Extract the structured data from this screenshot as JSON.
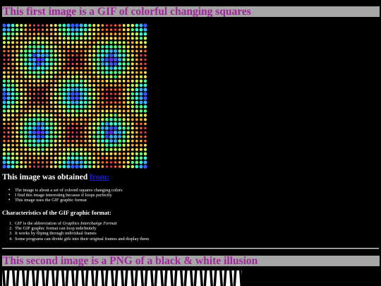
{
  "section1": {
    "heading": "This first image is a GIF of colorful changing squares",
    "obtained_prefix": "This image was obtained ",
    "obtained_link": "from:",
    "bullets": [
      "The image is about a set of colored squares changing colors",
      "I find this image interesting because if loops perfectly",
      "This image uses the GIF graphic format"
    ],
    "characteristics_heading": "Characteristics of the GIF graphic format:",
    "ordered": [
      {
        "num": "1.",
        "text": "GIF is the abbreviation of ",
        "em": "Graphics Interchange Format"
      },
      {
        "num": "2.",
        "text": "The GIF graphic format can loop indefinitely",
        "em": ""
      },
      {
        "num": "3.",
        "text": "It works by fliping through individual frames",
        "em": ""
      },
      {
        "num": "4.",
        "text": "Some programs can divide gifs into their original frames and display them",
        "em": ""
      }
    ]
  },
  "section2": {
    "heading": "This second image is a PNG of a black & white illusion"
  },
  "colors": {
    "banner_bg": "#a6a6a6",
    "banner_text": "#a0259a",
    "link": "#1a1ad9",
    "dot_palette": [
      "#1a0a2a",
      "#3a1040",
      "#7a1e5a",
      "#c02a60",
      "#e0405a",
      "#ff6a3a",
      "#ffb03a",
      "#ffe25a",
      "#c8ff5a",
      "#5aff8a",
      "#3affd0",
      "#3ab0ff",
      "#3a5aff",
      "#6a2aff",
      "#b01aff"
    ]
  }
}
